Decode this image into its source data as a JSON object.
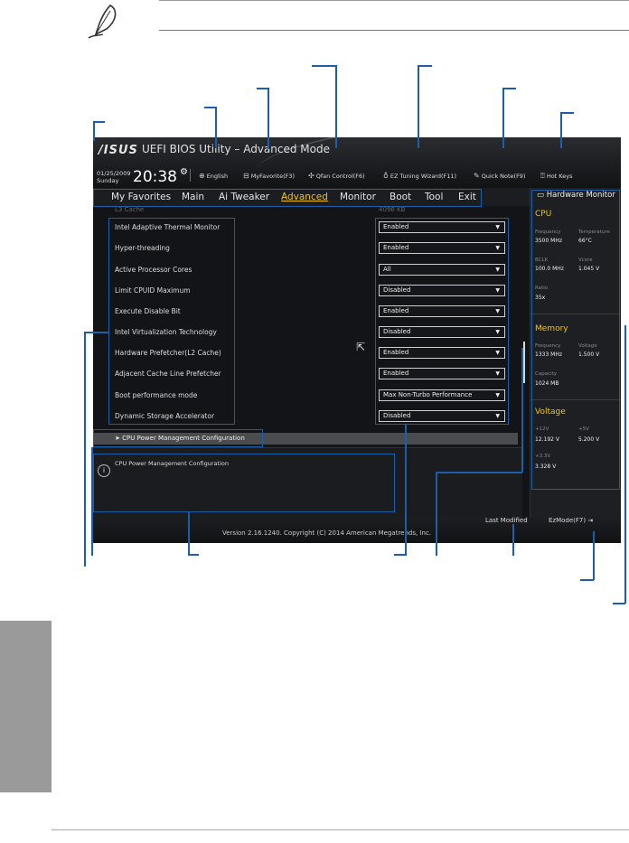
{
  "bios": {
    "logo": "/ISUS",
    "title": "UEFI BIOS Utility – Advanced Mode",
    "date": "01/25/2009",
    "day": "Sunday",
    "time": "20:38",
    "toolbar": [
      {
        "icon": "globe-icon",
        "label": "English"
      },
      {
        "icon": "myfavorite-icon",
        "label": "MyFavorite(F3)"
      },
      {
        "icon": "fan-icon",
        "label": "Qfan Control(F6)"
      },
      {
        "icon": "bulb-icon",
        "label": "EZ Tuning Wizard(F11)"
      },
      {
        "icon": "note-icon",
        "label": "Quick Note(F9)"
      },
      {
        "icon": "hotkeys-icon",
        "label": "Hot Keys"
      }
    ],
    "menu": [
      "My Favorites",
      "Main",
      "Ai Tweaker",
      "Advanced",
      "Monitor",
      "Boot",
      "Tool",
      "Exit"
    ],
    "active_menu": "Advanced",
    "cache_row": {
      "label": "L3 Cache",
      "value": "4096 KB"
    },
    "settings": [
      {
        "label": "Intel Adaptive Thermal Monitor",
        "value": "Enabled"
      },
      {
        "label": "Hyper-threading",
        "value": "Enabled"
      },
      {
        "label": "Active Processor Cores",
        "value": "All"
      },
      {
        "label": "Limit CPUID Maximum",
        "value": "Disabled"
      },
      {
        "label": "Execute Disable Bit",
        "value": "Enabled"
      },
      {
        "label": "Intel Virtualization Technology",
        "value": "Disabled"
      },
      {
        "label": "Hardware Prefetcher(L2 Cache)",
        "value": "Enabled"
      },
      {
        "label": "Adjacent Cache Line Prefetcher",
        "value": "Enabled"
      },
      {
        "label": "Boot performance mode",
        "value": "Max Non-Turbo Performance"
      },
      {
        "label": "Dynamic Storage Accelerator",
        "value": "Disabled"
      }
    ],
    "submenu": "CPU Power Management Configuration",
    "help_text": "CPU Power Management Configuration",
    "last_modified": "Last Modified",
    "ezmode": "EzMode(F7)",
    "version": "Version 2.16.1240. Copyright (C) 2014 American Megatrends, Inc."
  },
  "hwmon": {
    "title": "Hardware Monitor",
    "cpu": {
      "heading": "CPU",
      "frequency_label": "Frequency",
      "frequency": "3500 MHz",
      "temperature_label": "Temperature",
      "temperature": "66°C",
      "bclk_label": "BCLK",
      "bclk": "100.0 MHz",
      "vcore_label": "Vcore",
      "vcore": "1.045 V",
      "ratio_label": "Ratio",
      "ratio": "35x"
    },
    "memory": {
      "heading": "Memory",
      "frequency_label": "Frequency",
      "frequency": "1333 MHz",
      "voltage_label": "Voltage",
      "voltage": "1.500 V",
      "capacity_label": "Capacity",
      "capacity": "1024 MB"
    },
    "voltage": {
      "heading": "Voltage",
      "v12_label": "+12V",
      "v12": "12.192 V",
      "v5_label": "+5V",
      "v5": "5.200 V",
      "v33_label": "+3.3V",
      "v33": "3.328 V"
    }
  },
  "colors": {
    "accent": "#f1c40f",
    "callout": "#1b5fa8",
    "bios_bg": "#121417"
  }
}
